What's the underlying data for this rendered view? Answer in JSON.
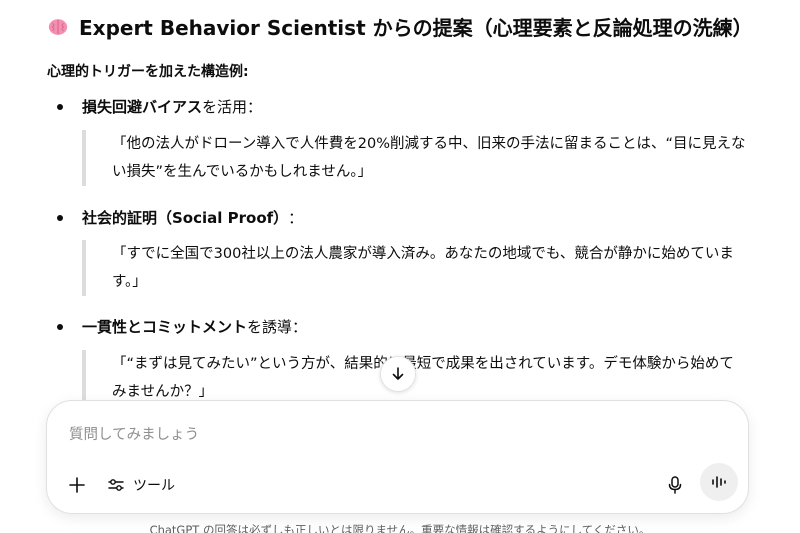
{
  "conversation": {
    "heading_text": "Expert Behavior Scientist からの提案（心理要素と反論処理の洗練）",
    "subheading": "心理的トリガーを加えた構造例:",
    "items": [
      {
        "bold": "損失回避バイアス",
        "suffix": "を活用：",
        "quote": "「他の法人がドローン導入で人件費を20%削減する中、旧来の手法に留まることは、“目に見えない損失”を生んでいるかもしれません。」"
      },
      {
        "bold": "社会的証明（Social Proof）",
        "suffix": "：",
        "quote": "「すでに全国で300社以上の法人農家が導入済み。あなたの地域でも、競合が静かに始めています。」"
      },
      {
        "bold": "一貫性とコミットメント",
        "suffix": "を誘導：",
        "quote": "「“まずは見てみたい”という方が、結果的に最短で成果を出されています。デモ体験から始めてみませんか？」"
      }
    ]
  },
  "composer": {
    "placeholder": "質問してみましょう",
    "tools_label": "ツール"
  },
  "footer": {
    "disclaimer": "ChatGPT の回答は必ずしも正しいとは限りません。重要な情報は確認するようにしてください。"
  },
  "icons": {
    "heading": "brain-icon",
    "scroll": "arrow-down-icon",
    "add": "plus-icon",
    "tools": "sliders-icon",
    "mic": "mic-icon",
    "voice": "voice-wave-icon"
  },
  "colors": {
    "quote_bar": "#dcdcdc",
    "brain_pink": "#f48fb1",
    "voice_button_bg": "#efefef"
  }
}
